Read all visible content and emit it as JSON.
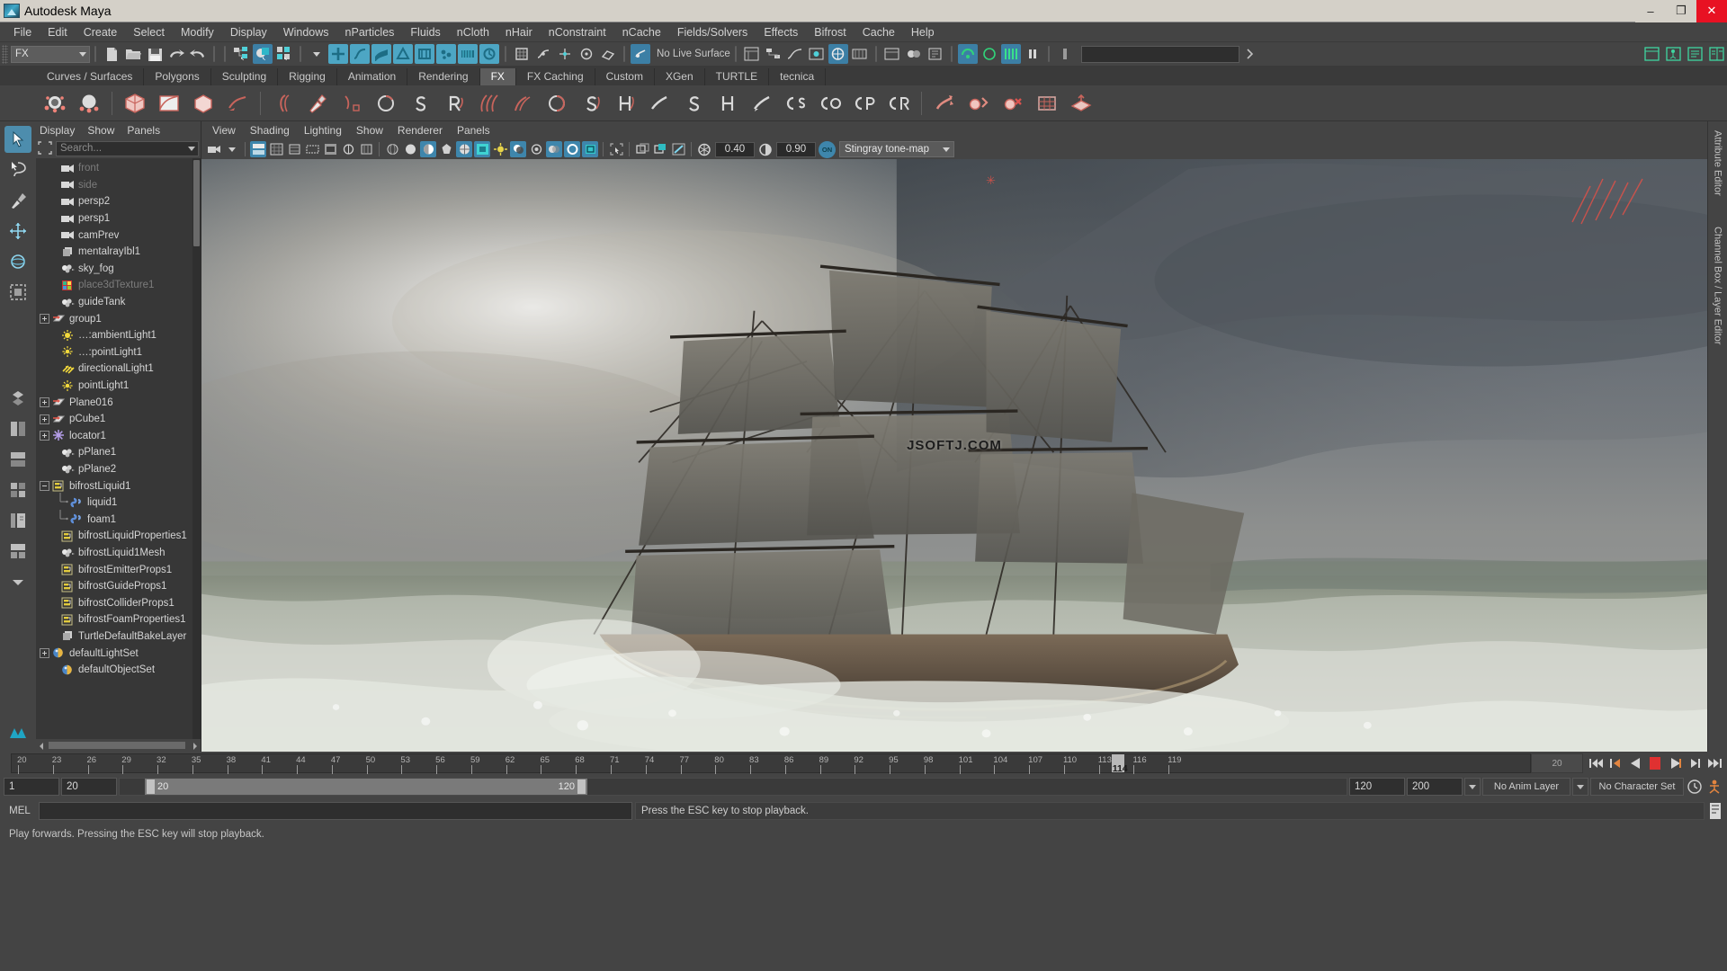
{
  "window": {
    "title": "Autodesk Maya",
    "app_icon": "maya-logo-icon",
    "minimize_label": "–",
    "maximize_label": "❐",
    "close_label": "✕"
  },
  "menubar": {
    "items": [
      {
        "label": "File"
      },
      {
        "label": "Edit"
      },
      {
        "label": "Create"
      },
      {
        "label": "Select"
      },
      {
        "label": "Modify"
      },
      {
        "label": "Display"
      },
      {
        "label": "Windows"
      },
      {
        "label": "nParticles"
      },
      {
        "label": "Fluids"
      },
      {
        "label": "nCloth"
      },
      {
        "label": "nHair"
      },
      {
        "label": "nConstraint"
      },
      {
        "label": "nCache"
      },
      {
        "label": "Fields/Solvers"
      },
      {
        "label": "Effects"
      },
      {
        "label": "Bifrost"
      },
      {
        "label": "Cache"
      },
      {
        "label": "Help"
      }
    ]
  },
  "statusbar": {
    "menuset": "FX",
    "no_live_surface": "No Live Surface",
    "input_field_value": ""
  },
  "shelf": {
    "tabs": [
      {
        "label": "Curves / Surfaces",
        "selected": false
      },
      {
        "label": "Polygons",
        "selected": false
      },
      {
        "label": "Sculpting",
        "selected": false
      },
      {
        "label": "Rigging",
        "selected": false
      },
      {
        "label": "Animation",
        "selected": false
      },
      {
        "label": "Rendering",
        "selected": false
      },
      {
        "label": "FX",
        "selected": true
      },
      {
        "label": "FX Caching",
        "selected": false
      },
      {
        "label": "Custom",
        "selected": false
      },
      {
        "label": "XGen",
        "selected": false
      },
      {
        "label": "TURTLE",
        "selected": false
      },
      {
        "label": "tecnica",
        "selected": false
      }
    ]
  },
  "outliner": {
    "menus": [
      {
        "label": "Display"
      },
      {
        "label": "Show"
      },
      {
        "label": "Panels"
      }
    ],
    "search_placeholder": "Search...",
    "items": [
      {
        "label": "front",
        "icon": "camera-icon",
        "indent": 1,
        "expander": "none",
        "dim": true
      },
      {
        "label": "side",
        "icon": "camera-icon",
        "indent": 1,
        "expander": "none",
        "dim": true
      },
      {
        "label": "persp2",
        "icon": "camera-icon",
        "indent": 1,
        "expander": "none",
        "dim": false
      },
      {
        "label": "persp1",
        "icon": "camera-icon",
        "indent": 1,
        "expander": "none",
        "dim": false
      },
      {
        "label": "camPrev",
        "icon": "camera-icon",
        "indent": 1,
        "expander": "none",
        "dim": false
      },
      {
        "label": "mentalrayIbl1",
        "icon": "layers-icon",
        "indent": 1,
        "expander": "none",
        "dim": false
      },
      {
        "label": "sky_fog",
        "icon": "mesh-icon",
        "indent": 1,
        "expander": "none",
        "dim": false
      },
      {
        "label": "place3dTexture1",
        "icon": "texture-icon",
        "indent": 1,
        "expander": "none",
        "dim": true
      },
      {
        "label": "guideTank",
        "icon": "mesh-icon",
        "indent": 1,
        "expander": "none",
        "dim": false
      },
      {
        "label": "group1",
        "icon": "transform-icon",
        "indent": 0,
        "expander": "plus",
        "dim": false
      },
      {
        "label": "…:ambientLight1",
        "icon": "ambient-light-icon",
        "indent": 1,
        "expander": "none",
        "dim": false
      },
      {
        "label": "…:pointLight1",
        "icon": "point-light-icon",
        "indent": 1,
        "expander": "none",
        "dim": false
      },
      {
        "label": "directionalLight1",
        "icon": "directional-light-icon",
        "indent": 1,
        "expander": "none",
        "dim": false
      },
      {
        "label": "pointLight1",
        "icon": "point-light-icon",
        "indent": 1,
        "expander": "none",
        "dim": false
      },
      {
        "label": "Plane016",
        "icon": "transform-icon",
        "indent": 0,
        "expander": "plus",
        "dim": false
      },
      {
        "label": "pCube1",
        "icon": "transform-icon",
        "indent": 0,
        "expander": "plus",
        "dim": false
      },
      {
        "label": "locator1",
        "icon": "locator-icon",
        "indent": 0,
        "expander": "plus",
        "dim": false
      },
      {
        "label": "pPlane1",
        "icon": "mesh-icon",
        "indent": 1,
        "expander": "none",
        "dim": false
      },
      {
        "label": "pPlane2",
        "icon": "mesh-icon",
        "indent": 1,
        "expander": "none",
        "dim": false
      },
      {
        "label": "bifrostLiquid1",
        "icon": "bifrost-icon",
        "indent": 0,
        "expander": "minus",
        "dim": false
      },
      {
        "label": "liquid1",
        "icon": "bifrost-link-icon",
        "indent": 2,
        "expander": "none",
        "dim": false,
        "tree": "tee"
      },
      {
        "label": "foam1",
        "icon": "bifrost-link-icon",
        "indent": 2,
        "expander": "none",
        "dim": false,
        "tree": "ell"
      },
      {
        "label": "bifrostLiquidProperties1",
        "icon": "bifrost-icon",
        "indent": 1,
        "expander": "none",
        "dim": false
      },
      {
        "label": "bifrostLiquid1Mesh",
        "icon": "mesh-icon",
        "indent": 1,
        "expander": "none",
        "dim": false
      },
      {
        "label": "bifrostEmitterProps1",
        "icon": "bifrost-icon",
        "indent": 1,
        "expander": "none",
        "dim": false
      },
      {
        "label": "bifrostGuideProps1",
        "icon": "bifrost-icon",
        "indent": 1,
        "expander": "none",
        "dim": false
      },
      {
        "label": "bifrostColliderProps1",
        "icon": "bifrost-icon",
        "indent": 1,
        "expander": "none",
        "dim": false
      },
      {
        "label": "bifrostFoamProperties1",
        "icon": "bifrost-icon",
        "indent": 1,
        "expander": "none",
        "dim": false
      },
      {
        "label": "TurtleDefaultBakeLayer",
        "icon": "layers-icon",
        "indent": 1,
        "expander": "none",
        "dim": false
      },
      {
        "label": "defaultLightSet",
        "icon": "set-icon",
        "indent": 0,
        "expander": "plus",
        "dim": false
      },
      {
        "label": "defaultObjectSet",
        "icon": "set-icon",
        "indent": 1,
        "expander": "none",
        "dim": false
      }
    ]
  },
  "viewport": {
    "menus": [
      {
        "label": "View"
      },
      {
        "label": "Shading"
      },
      {
        "label": "Lighting"
      },
      {
        "label": "Show"
      },
      {
        "label": "Renderer"
      },
      {
        "label": "Panels"
      }
    ],
    "exposure_value": "0.40",
    "gamma_value": "0.90",
    "tonemap_toggle": "ON",
    "tonemap_label": "Stingray tone-map",
    "watermark": "JSOFTJ.COM",
    "scene_description": "Tall sailing ship on stormy sea rendered in viewport"
  },
  "right_panels": [
    {
      "label": "Attribute Editor"
    },
    {
      "label": "Channel Box / Layer Editor"
    }
  ],
  "timeline": {
    "ticks": [
      "20",
      "23",
      "26",
      "29",
      "32",
      "35",
      "38",
      "41",
      "44",
      "47",
      "50",
      "53",
      "56",
      "59",
      "62",
      "65",
      "68",
      "71",
      "74",
      "77",
      "80",
      "83",
      "86",
      "89",
      "92",
      "95",
      "98",
      "101",
      "104",
      "107",
      "110",
      "113",
      "116",
      "119"
    ],
    "current_frame": "114",
    "frame_field": "20",
    "playback_controls": [
      {
        "name": "go-to-start-button",
        "glyph": "skip-start"
      },
      {
        "name": "step-back-frame-button",
        "glyph": "prev-key"
      },
      {
        "name": "play-backwards-button",
        "glyph": "play-back"
      },
      {
        "name": "stop-playback-button",
        "glyph": "stop"
      },
      {
        "name": "play-forwards-button",
        "glyph": "play-fwd"
      },
      {
        "name": "step-forward-frame-button",
        "glyph": "next-key"
      },
      {
        "name": "go-to-end-button",
        "glyph": "skip-end"
      }
    ]
  },
  "range": {
    "anim_start": "1",
    "range_start": "20",
    "slider_min_label": "20",
    "slider_max_label": "120",
    "range_end": "120",
    "anim_end": "200",
    "anim_layer": "No Anim Layer",
    "character_set": "No Character Set"
  },
  "command": {
    "language_label": "MEL",
    "input_value": "",
    "response_text": "Press the ESC key to stop playback."
  },
  "helpline": {
    "text": "Play forwards. Pressing the ESC key will stop playback."
  },
  "colors": {
    "accent_blue": "#3e86ac",
    "accent_blue_bright": "#4da6c4",
    "panel_bg": "#444444",
    "outliner_bg": "#373737",
    "stop_red": "#e03131",
    "titlebar_bg": "#d4d0c8",
    "close_red": "#e81123",
    "light_yellow": "#e8d44a"
  }
}
